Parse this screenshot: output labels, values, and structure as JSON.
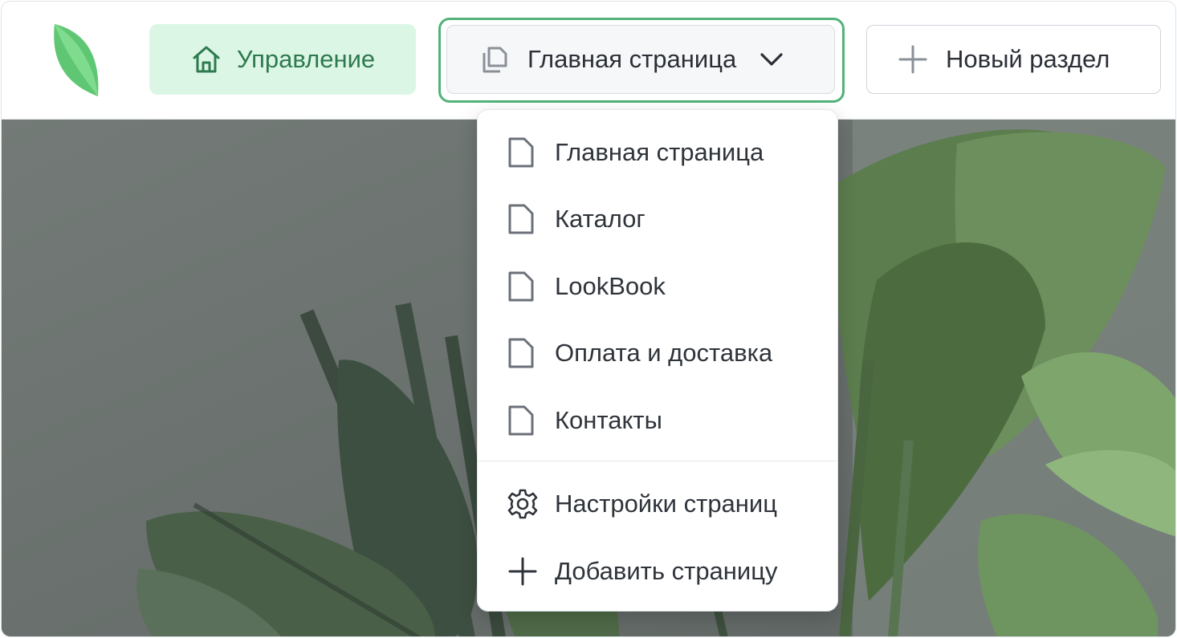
{
  "header": {
    "logo_icon": "leaf-logo",
    "manage_button": {
      "label": "Управление",
      "icon": "home-icon",
      "bg": "#dcf6e6",
      "color": "#2d7a4e"
    },
    "page_selector": {
      "label": "Главная страница",
      "icon": "copy-pages-icon",
      "chevron": "chevron-down-icon",
      "accent": "#52b27a"
    },
    "new_section_button": {
      "label": "Новый раздел",
      "icon": "plus-icon"
    }
  },
  "dropdown": {
    "pages": [
      {
        "label": "Главная страница",
        "icon": "page-icon"
      },
      {
        "label": "Каталог",
        "icon": "page-icon"
      },
      {
        "label": "LookBook",
        "icon": "page-icon"
      },
      {
        "label": "Оплата и доставка",
        "icon": "page-icon"
      },
      {
        "label": "Контакты",
        "icon": "page-icon"
      }
    ],
    "settings": {
      "label": "Настройки страниц",
      "icon": "gear-icon"
    },
    "add_page": {
      "label": "Добавить страницу",
      "icon": "plus-icon"
    }
  },
  "hero": {
    "image": "tropical-plant-photo"
  }
}
